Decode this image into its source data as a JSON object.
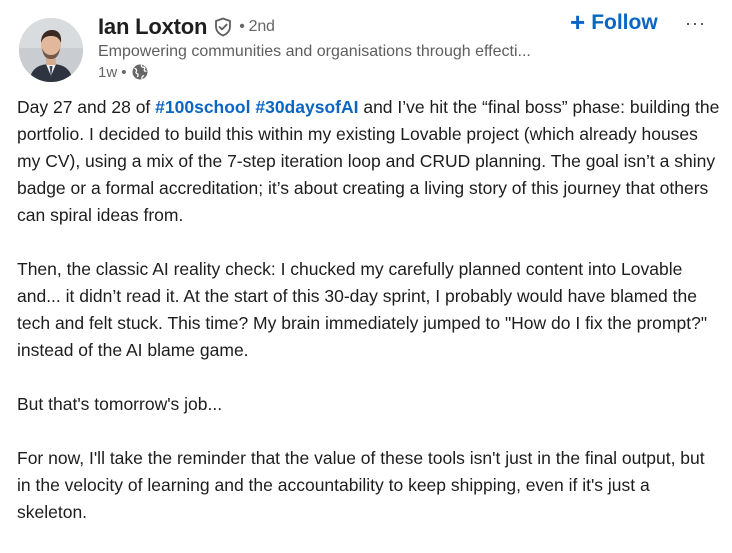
{
  "author": {
    "name": "Ian Loxton",
    "degree": "2nd",
    "headline": "Empowering communities and organisations through effecti...",
    "time": "1w",
    "avatar_icon": "profile-photo",
    "verified_icon": "verified-shield-icon",
    "visibility_icon": "globe-icon"
  },
  "actions": {
    "follow_label": "Follow",
    "follow_plus": "+",
    "more_label": "···"
  },
  "colors": {
    "accent": "#0a66c2",
    "text": "#1d1d1d",
    "muted": "#666666"
  },
  "post": {
    "p1_before": "Day 27 and 28 of ",
    "p1_tag1": "#100school",
    "p1_space": " ",
    "p1_tag2": "#30daysofAI",
    "p1_after": " and I’ve hit the “final boss” phase: building the portfolio. I decided to build this within my existing Lovable project (which already houses my CV), using a mix of the 7-step iteration loop and CRUD planning. The goal isn’t a shiny badge or a formal accreditation; it’s about creating a living story of this journey that others can spiral ideas from.",
    "p2": "Then, the classic AI reality check: I chucked my carefully planned content into Lovable and... it didn’t read it. At the start of this 30-day sprint, I probably would have blamed the tech and felt stuck. This time? My brain immediately jumped to \"How do I fix the prompt?\" instead of the AI blame game.",
    "p3": "But that's tomorrow's job...",
    "p4": "For now, I'll take the reminder that the value of these tools isn't just in the final output, but in the velocity of learning and the accountability to keep shipping, even if it's just a skeleton."
  }
}
